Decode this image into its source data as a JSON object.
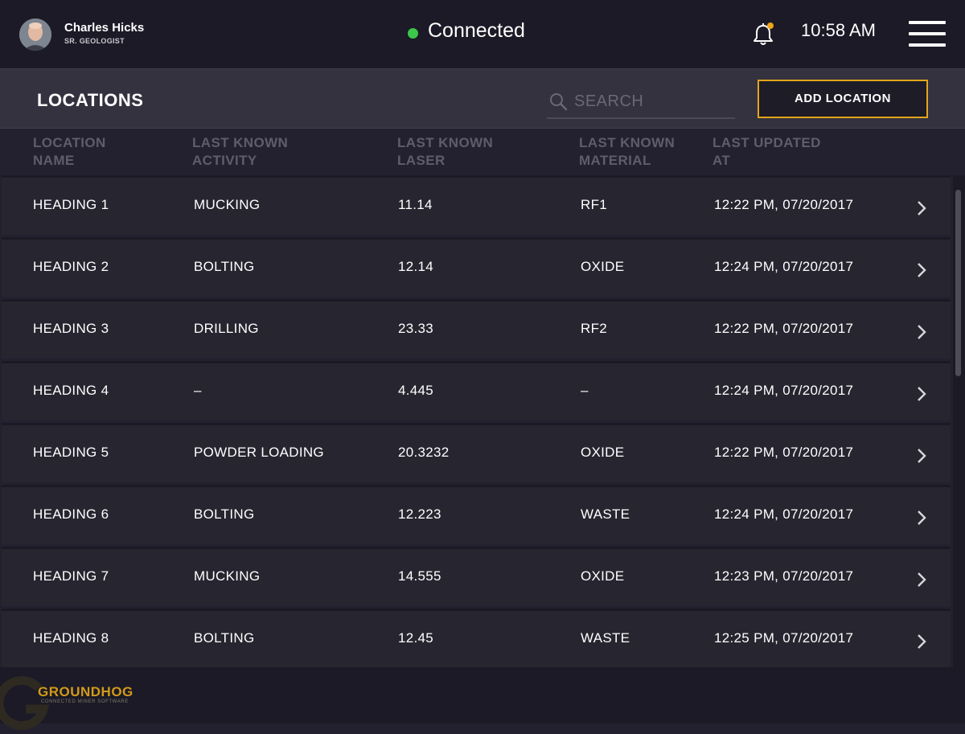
{
  "user": {
    "name": "Charles Hicks",
    "role": "SR. GEOLOGIST"
  },
  "connection": {
    "status": "Connected",
    "color": "#3cc64a"
  },
  "clock": "10:58 AM",
  "icons": {
    "notification": "bell-icon",
    "menu": "hamburger-menu-icon",
    "search": "search-icon",
    "row_action": "chevron-right-icon"
  },
  "header": {
    "title": "LOCATIONS",
    "search_placeholder": "SEARCH",
    "add_button": "ADD LOCATION"
  },
  "columns": [
    "LOCATION\nNAME",
    "LAST KNOWN\nACTIVITY",
    "LAST KNOWN\nLASER",
    "LAST KNOWN\nMATERIAL",
    "LAST UPDATED\nAT"
  ],
  "rows": [
    {
      "name": "HEADING 1",
      "activity": "MUCKING",
      "laser": "11.14",
      "material": "RF1",
      "updated": "12:22 PM, 07/20/2017"
    },
    {
      "name": "HEADING 2",
      "activity": "BOLTING",
      "laser": "12.14",
      "material": "OXIDE",
      "updated": "12:24 PM, 07/20/2017"
    },
    {
      "name": "HEADING 3",
      "activity": "DRILLING",
      "laser": "23.33",
      "material": "RF2",
      "updated": "12:22 PM, 07/20/2017"
    },
    {
      "name": "HEADING 4",
      "activity": "–",
      "laser": "4.445",
      "material": "–",
      "updated": "12:24 PM, 07/20/2017"
    },
    {
      "name": "HEADING 5",
      "activity": "POWDER LOADING",
      "laser": "20.3232",
      "material": "OXIDE",
      "updated": "12:22 PM, 07/20/2017"
    },
    {
      "name": "HEADING 6",
      "activity": "BOLTING",
      "laser": "12.223",
      "material": "WASTE",
      "updated": "12:24 PM, 07/20/2017"
    },
    {
      "name": "HEADING 7",
      "activity": "MUCKING",
      "laser": "14.555",
      "material": "OXIDE",
      "updated": "12:23 PM, 07/20/2017"
    },
    {
      "name": "HEADING 8",
      "activity": "BOLTING",
      "laser": "12.45",
      "material": "WASTE",
      "updated": "12:25 PM, 07/20/2017"
    }
  ],
  "footer": {
    "brand": "GROUNDHOG",
    "tagline": "CONNECTED MINER SOFTWARE"
  },
  "colors": {
    "accent": "#e3a51c",
    "background": "#23212f",
    "bar": "#1b1a26"
  }
}
